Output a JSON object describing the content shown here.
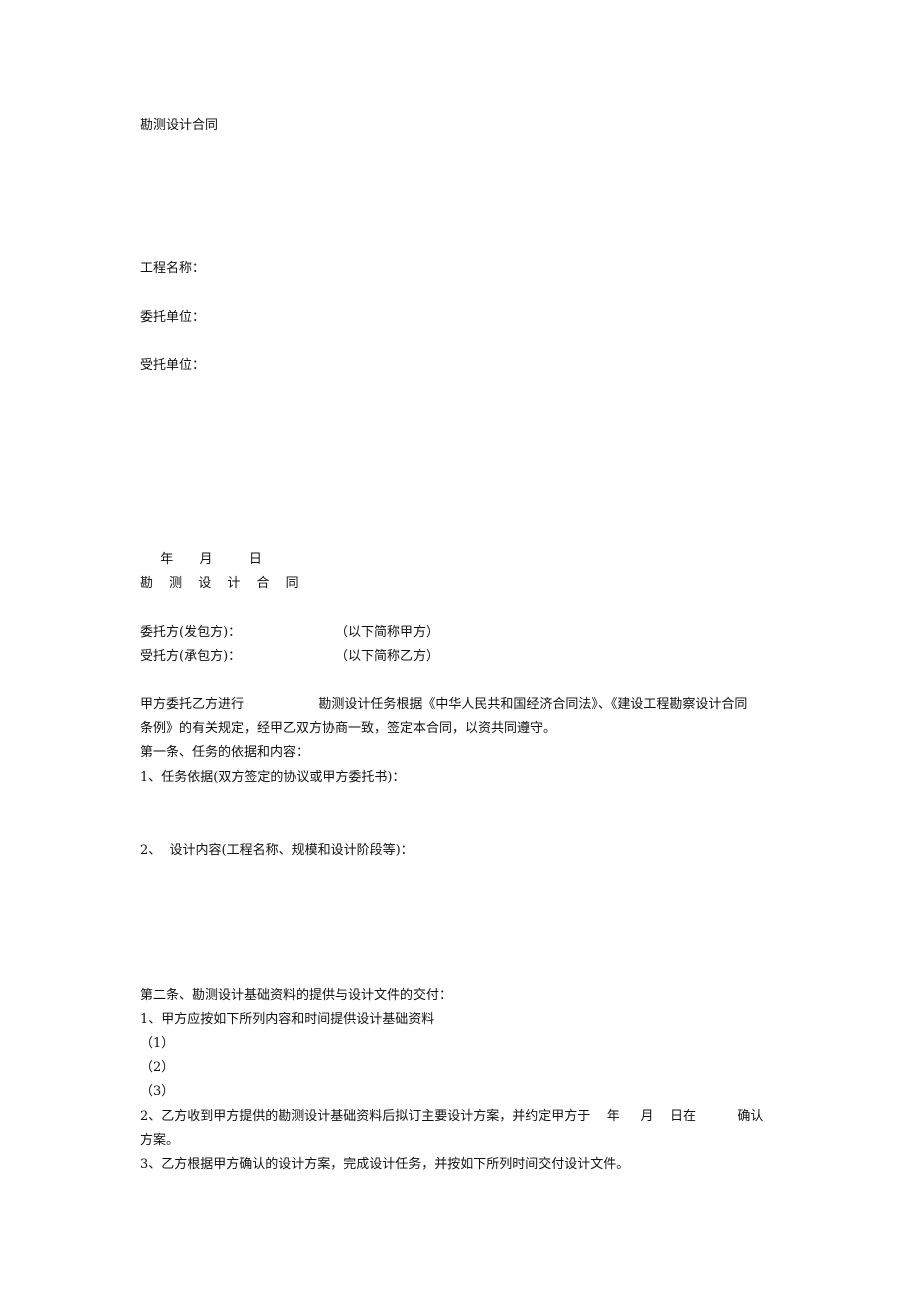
{
  "cover": {
    "title": "勘测设计合同",
    "project_name_label": "工程名称：",
    "client_label": "委托单位：",
    "contractor_label": "受托单位：",
    "date_line": "  年  月   日"
  },
  "contract": {
    "heading": "勘 测 设 计 合 同",
    "party_a_label": "委托方(发包方)：",
    "party_a_note": "（以下简称甲方）",
    "party_b_label": "受托方(承包方)：",
    "party_b_note": "（以下简称乙方）",
    "preamble_line1": "甲方委托乙方进行                  勘测设计任务根据《中华人民共和国经济合同法》、《建设工程勘察设计合同",
    "preamble_line2": "条例》的有关规定，经甲乙双方协商一致，签定本合同，以资共同遵守。",
    "article1": {
      "title": "第一条、任务的依据和内容：",
      "item1": "1、任务依据(双方签定的协议或甲方委托书)：",
      "item2": "2、  设计内容(工程名称、规模和设计阶段等)："
    },
    "article2": {
      "title": "第二条、勘测设计基础资料的提供与设计文件的交付：",
      "item1": "1、甲方应按如下所列内容和时间提供设计基础资料",
      "sub1": "（1）",
      "sub2": "（2）",
      "sub3": "（3）",
      "item2_line1": "2、乙方收到甲方提供的勘测设计基础资料后拟订主要设计方案，并约定甲方于    年     月    日在          确认",
      "item2_line2": "方案。",
      "item3": "3、乙方根据甲方确认的设计方案，完成设计任务，并按如下所列时间交付设计文件。"
    }
  }
}
